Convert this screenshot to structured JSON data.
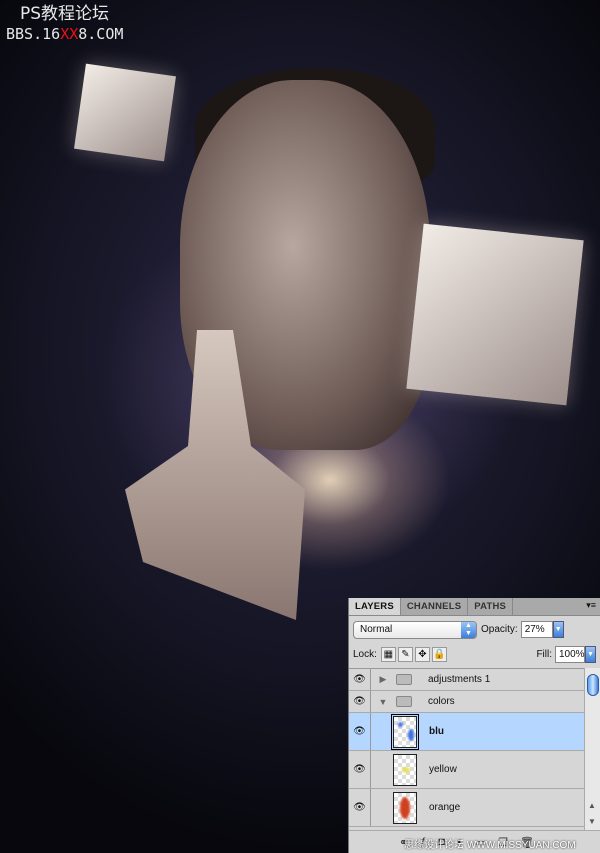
{
  "watermark": {
    "line1": "PS教程论坛",
    "line2_a": "BBS.16",
    "line2_b": "XX",
    "line2_c": "8.COM",
    "bottom": "思缘设计论坛 WWW.MISSYUAN.COM"
  },
  "panel": {
    "tabs": [
      {
        "label": "LAYERS",
        "active": true
      },
      {
        "label": "CHANNELS"
      },
      {
        "label": "PATHS"
      }
    ],
    "blend_mode": "Normal",
    "opacity_label": "Opacity:",
    "opacity": "27%",
    "lock_label": "Lock:",
    "fill_label": "Fill:",
    "fill": "100%",
    "layers": [
      {
        "name": "adjustments 1",
        "type": "group",
        "expanded": false,
        "visible": true
      },
      {
        "name": "colors",
        "type": "group",
        "expanded": true,
        "visible": true
      },
      {
        "name": "blu",
        "type": "layer",
        "selected": true,
        "visible": true,
        "color": "#3a6fe0"
      },
      {
        "name": "yellow",
        "type": "layer",
        "visible": true,
        "color": "#e8e060"
      },
      {
        "name": "orange",
        "type": "layer",
        "visible": true,
        "color": "#d0401e"
      }
    ],
    "selection_color": "#b5d7ff"
  }
}
